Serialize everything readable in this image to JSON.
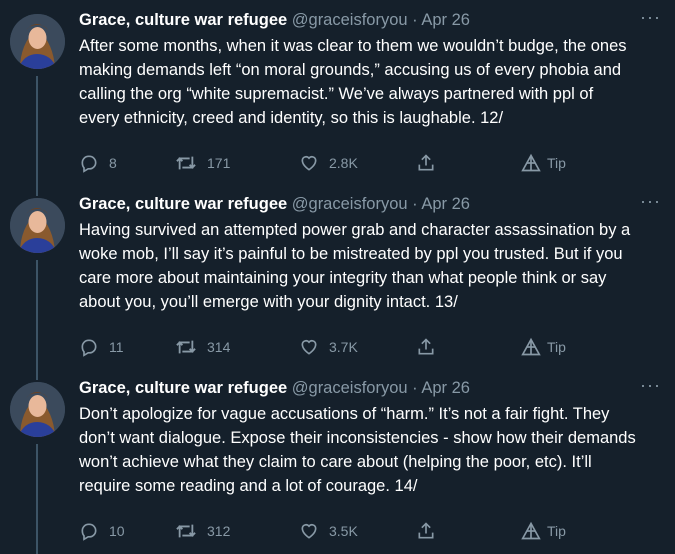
{
  "tweets": [
    {
      "author_name": "Grace, culture war refugee",
      "handle": "@graceisforyou",
      "separator": "·",
      "date": "Apr 26",
      "more": "···",
      "lines": [
        "After some months, when it was clear to them we wouldn’t budge, the ones",
        "making demands left “on moral grounds,” accusing us of every phobia and",
        "calling the org “white supremacist.” We’ve always partnered with ppl of",
        "every ethnicity, creed and identity, so this is laughable. 12/"
      ],
      "replies": "8",
      "retweets": "171",
      "likes": "2.8K",
      "tip_label": "Tip"
    },
    {
      "author_name": "Grace, culture war refugee",
      "handle": "@graceisforyou",
      "separator": "·",
      "date": "Apr 26",
      "more": "···",
      "lines": [
        "Having survived an attempted power grab and character assassination by a",
        "woke mob, I’ll say it’s painful to be mistreated by ppl you trusted. But if you",
        "care more about maintaining your integrity than what people think or say",
        "about you, you’ll emerge with your dignity intact. 13/"
      ],
      "replies": "11",
      "retweets": "314",
      "likes": "3.7K",
      "tip_label": "Tip"
    },
    {
      "author_name": "Grace, culture war refugee",
      "handle": "@graceisforyou",
      "separator": "·",
      "date": "Apr 26",
      "more": "···",
      "lines": [
        "Don’t apologize for vague accusations of “harm.” It’s not a fair fight. They",
        "don’t want dialogue. Expose their inconsistencies - show how their demands",
        "won’t achieve what they claim to care about (helping the poor, etc). It’ll",
        "require some reading and a lot of courage. 14/"
      ],
      "replies": "10",
      "retweets": "312",
      "likes": "3.5K",
      "tip_label": "Tip"
    }
  ],
  "icons": {
    "reply": "reply-icon",
    "retweet": "retweet-icon",
    "like": "like-icon",
    "share": "share-icon",
    "tip": "tip-icon",
    "more": "more-icon"
  },
  "colors": {
    "background": "#15202b",
    "text": "#ffffff",
    "muted": "#8899a6",
    "thread_line": "#3d5466"
  }
}
